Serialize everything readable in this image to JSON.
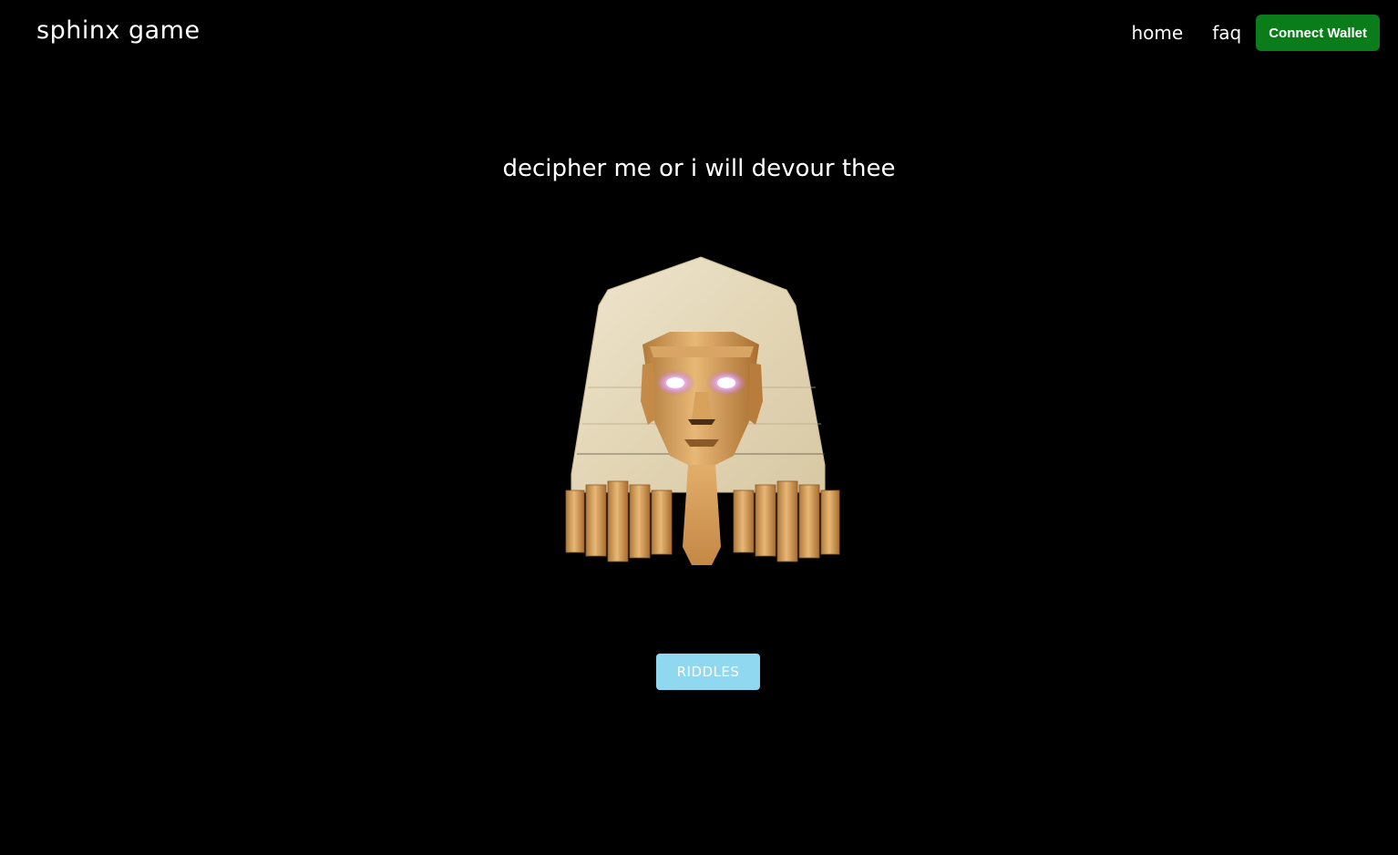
{
  "header": {
    "brand": "sphinx game",
    "nav": {
      "home": "home",
      "faq": "faq"
    },
    "connect_wallet": "Connect Wallet"
  },
  "main": {
    "headline": "decipher me or i will devour thee",
    "hero_image": "sphinx-head-illustration",
    "cta": "RIDDLES"
  },
  "colors": {
    "background": "#000000",
    "wallet_button": "#0a7d1a",
    "riddles_button": "#8fd8f0",
    "text": "#ffffff"
  }
}
